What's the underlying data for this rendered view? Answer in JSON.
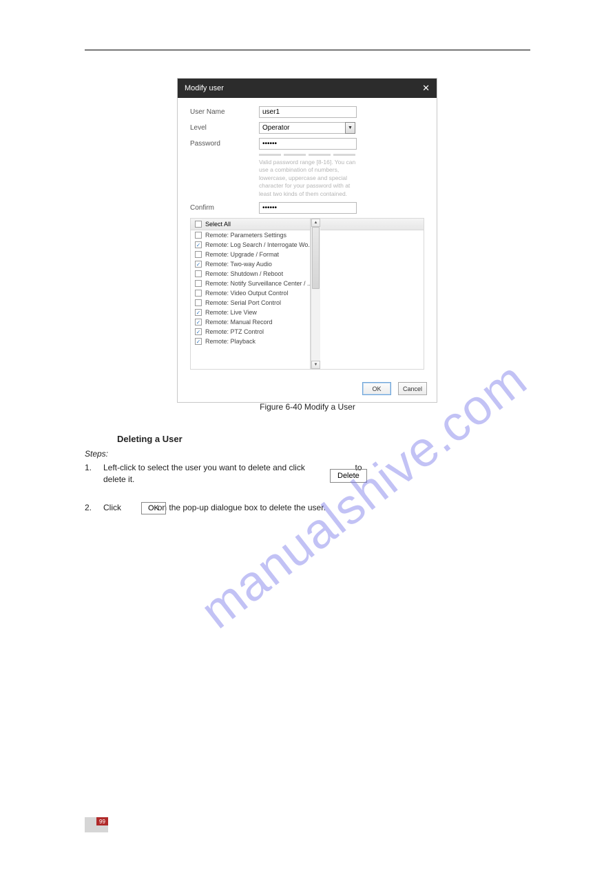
{
  "dialog": {
    "title": "Modify user",
    "fields": {
      "username_label": "User Name",
      "username_value": "user1",
      "level_label": "Level",
      "level_value": "Operator",
      "password_label": "Password",
      "password_value": "••••••",
      "password_hint": "Valid password range [8-16]. You can use a combination of numbers, lowercase, uppercase and special character for your password with at least two kinds of them contained.",
      "confirm_label": "Confirm",
      "confirm_value": "••••••"
    },
    "select_all_label": "Select All",
    "permissions": [
      {
        "label": "Remote: Parameters Settings",
        "checked": false
      },
      {
        "label": "Remote: Log Search / Interrogate Wo...",
        "checked": true
      },
      {
        "label": "Remote: Upgrade / Format",
        "checked": false
      },
      {
        "label": "Remote: Two-way Audio",
        "checked": true
      },
      {
        "label": "Remote: Shutdown / Reboot",
        "checked": false
      },
      {
        "label": "Remote: Notify Surveillance Center / ...",
        "checked": false
      },
      {
        "label": "Remote: Video Output Control",
        "checked": false
      },
      {
        "label": "Remote: Serial Port Control",
        "checked": false
      },
      {
        "label": "Remote: Live View",
        "checked": true
      },
      {
        "label": "Remote: Manual Record",
        "checked": true
      },
      {
        "label": "Remote: PTZ Control",
        "checked": true
      },
      {
        "label": "Remote: Playback",
        "checked": true
      }
    ],
    "ok_label": "OK",
    "cancel_label": "Cancel"
  },
  "caption": "Figure 6-40 Modify a User",
  "delete_section": {
    "heading": "Deleting a User",
    "steps_label": "Steps:",
    "step1_num": "1.",
    "step1_line1": "Left-click to select the user you want to delete and click",
    "step1_line2": "delete it.",
    "delete_btn": "Delete",
    "step1_tail": "to",
    "step2_num": "2.",
    "step2_before": "Click",
    "ok_btn": "OK",
    "step2_after": "on the pop-up dialogue box to delete the user."
  },
  "watermark": "manualshive.com",
  "page_number": "99"
}
